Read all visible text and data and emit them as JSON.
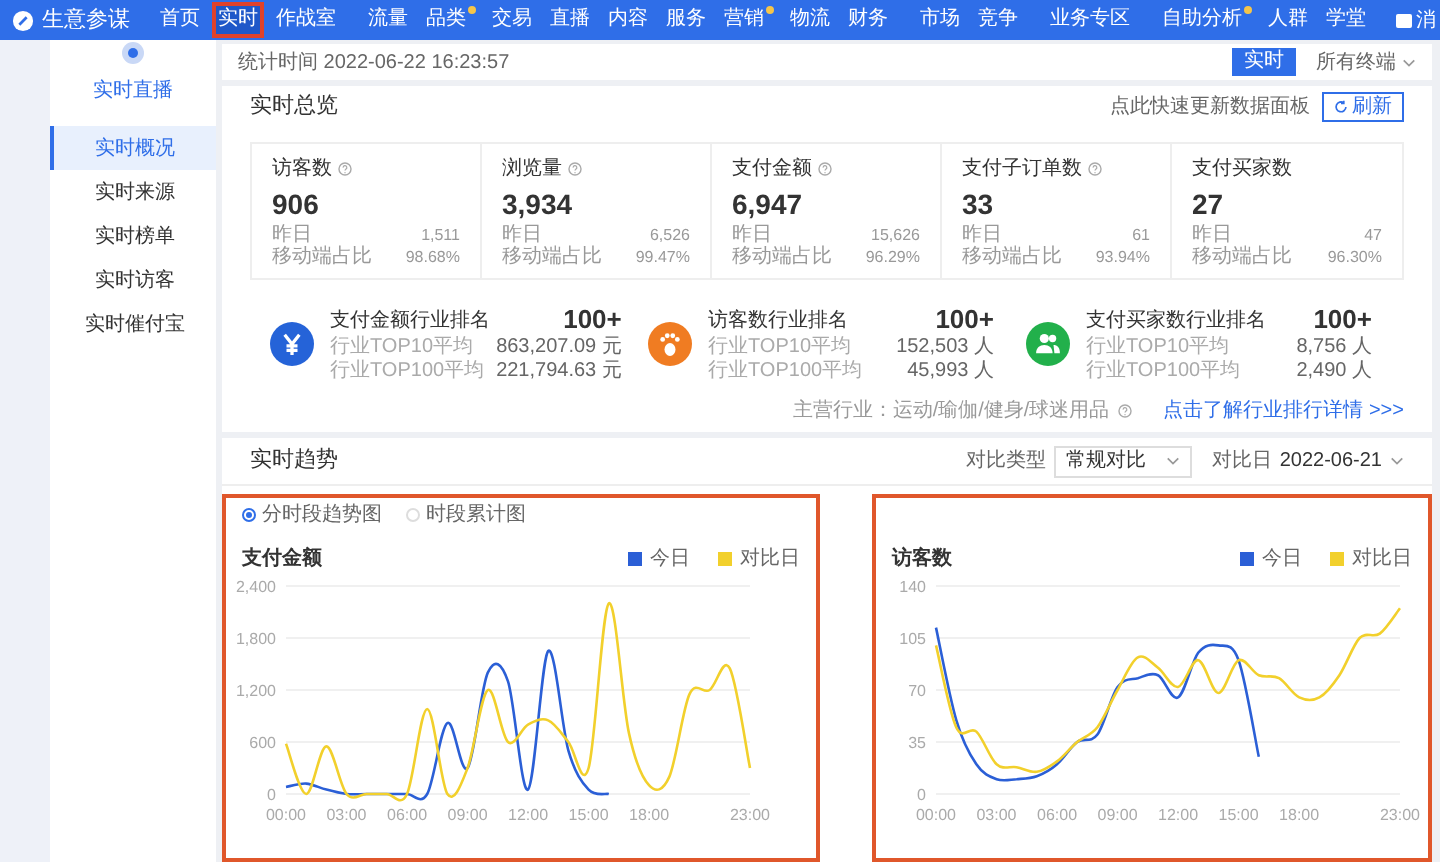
{
  "app": {
    "title": "生意参谋"
  },
  "nav_groups": [
    [
      {
        "label": "首页",
        "selected": false,
        "highlighted": false,
        "dot": false
      },
      {
        "label": "实时",
        "selected": true,
        "highlighted": true,
        "dot": false
      },
      {
        "label": "作战室",
        "selected": false,
        "highlighted": false,
        "dot": false
      }
    ],
    [
      {
        "label": "流量",
        "selected": false,
        "highlighted": false,
        "dot": false
      },
      {
        "label": "品类",
        "selected": false,
        "highlighted": false,
        "dot": true
      },
      {
        "label": "交易",
        "selected": false,
        "highlighted": false,
        "dot": false
      },
      {
        "label": "直播",
        "selected": false,
        "highlighted": false,
        "dot": false
      },
      {
        "label": "内容",
        "selected": false,
        "highlighted": false,
        "dot": false
      },
      {
        "label": "服务",
        "selected": false,
        "highlighted": false,
        "dot": false
      },
      {
        "label": "营销",
        "selected": false,
        "highlighted": false,
        "dot": true
      },
      {
        "label": "物流",
        "selected": false,
        "highlighted": false,
        "dot": false
      },
      {
        "label": "财务",
        "selected": false,
        "highlighted": false,
        "dot": false
      }
    ],
    [
      {
        "label": "市场",
        "selected": false,
        "highlighted": false,
        "dot": false
      },
      {
        "label": "竞争",
        "selected": false,
        "highlighted": false,
        "dot": false
      }
    ],
    [
      {
        "label": "业务专区",
        "selected": false,
        "highlighted": false,
        "dot": false
      }
    ],
    [
      {
        "label": "自助分析",
        "selected": false,
        "highlighted": false,
        "dot": true
      },
      {
        "label": "人群",
        "selected": false,
        "highlighted": false,
        "dot": false
      },
      {
        "label": "学堂",
        "selected": false,
        "highlighted": false,
        "dot": false
      }
    ]
  ],
  "messages": "消",
  "sidebar": {
    "title": "实时直播",
    "items": [
      {
        "label": "实时概况",
        "selected": true
      },
      {
        "label": "实时来源",
        "selected": false
      },
      {
        "label": "实时榜单",
        "selected": false
      },
      {
        "label": "实时访客",
        "selected": false
      },
      {
        "label": "实时催付宝",
        "selected": false
      }
    ]
  },
  "toolbar": {
    "stat_time": "统计时间 2022-06-22 16:23:57",
    "mode_button": "实时",
    "terminal": "所有终端"
  },
  "overview": {
    "title": "实时总览",
    "refresh_hint": "点此快速更新数据面板",
    "refresh_button": "刷新",
    "metrics": [
      {
        "label": "访客数",
        "help": true,
        "value": "906",
        "yesterday_label": "昨日",
        "yesterday": "1,511",
        "mobile_label": "移动端占比",
        "mobile": "98.68%"
      },
      {
        "label": "浏览量",
        "help": true,
        "value": "3,934",
        "yesterday_label": "昨日",
        "yesterday": "6,526",
        "mobile_label": "移动端占比",
        "mobile": "99.47%"
      },
      {
        "label": "支付金额",
        "help": true,
        "value": "6,947",
        "yesterday_label": "昨日",
        "yesterday": "15,626",
        "mobile_label": "移动端占比",
        "mobile": "96.29%"
      },
      {
        "label": "支付子订单数",
        "help": true,
        "value": "33",
        "yesterday_label": "昨日",
        "yesterday": "61",
        "mobile_label": "移动端占比",
        "mobile": "93.94%"
      },
      {
        "label": "支付买家数",
        "help": false,
        "value": "27",
        "yesterday_label": "昨日",
        "yesterday": "47",
        "mobile_label": "移动端占比",
        "mobile": "96.30%"
      }
    ],
    "rankings": [
      {
        "kind": "yuan",
        "color": "#2563d8",
        "title": "支付金额行业排名",
        "rank": "100+",
        "rows": [
          {
            "label": "行业TOP10平均",
            "value": "863,207.09 元"
          },
          {
            "label": "行业TOP100平均",
            "value": "221,794.63 元"
          }
        ]
      },
      {
        "kind": "footprint",
        "color": "#f07c22",
        "title": "访客数行业排名",
        "rank": "100+",
        "rows": [
          {
            "label": "行业TOP10平均",
            "value": "152,503 人"
          },
          {
            "label": "行业TOP100平均",
            "value": "45,993 人"
          }
        ]
      },
      {
        "kind": "people",
        "color": "#22b04b",
        "title": "支付买家数行业排名",
        "rank": "100+",
        "rows": [
          {
            "label": "行业TOP10平均",
            "value": "8,756 人"
          },
          {
            "label": "行业TOP100平均",
            "value": "2,490 人"
          }
        ]
      }
    ],
    "industry": "主营行业：运动/瑜伽/健身/球迷用品",
    "industry_link": "点击了解行业排行详情 >>>"
  },
  "trend": {
    "title": "实时趋势",
    "compare_type_label": "对比类型",
    "compare_type": "常规对比",
    "compare_day_label": "对比日",
    "compare_day": "2022-06-21",
    "panels": [
      {
        "highlighted": true,
        "view_options": [
          {
            "label": "分时段趋势图",
            "selected": true
          },
          {
            "label": "时段累计图",
            "selected": false
          }
        ],
        "chart_data": {
          "type": "line",
          "title": "支付金额",
          "grid": true,
          "legend": "top-right",
          "x": [
            0,
            1,
            2,
            3,
            4,
            5,
            6,
            7,
            8,
            9,
            10,
            11,
            12,
            13,
            14,
            15,
            16,
            17,
            18,
            19,
            20,
            21,
            22,
            23
          ],
          "xlim": [
            0,
            23
          ],
          "ylim": [
            0,
            2400
          ],
          "yticks": [
            {
              "value": 0,
              "label": "0"
            },
            {
              "value": 600,
              "label": "600"
            },
            {
              "value": 1200,
              "label": "1,200"
            },
            {
              "value": 1800,
              "label": "1,800"
            },
            {
              "value": 2400,
              "label": "2,400"
            }
          ],
          "xticks": [
            {
              "value": 0,
              "label": "00:00"
            },
            {
              "value": 3,
              "label": "03:00"
            },
            {
              "value": 6,
              "label": "06:00"
            },
            {
              "value": 9,
              "label": "09:00"
            },
            {
              "value": 12,
              "label": "12:00"
            },
            {
              "value": 15,
              "label": "15:00"
            },
            {
              "value": 18,
              "label": "18:00"
            },
            {
              "value": 23,
              "label": "23:00"
            }
          ],
          "series": [
            {
              "name": "今日",
              "color": "#2b5fd6",
              "values": [
                80,
                120,
                50,
                0,
                0,
                0,
                0,
                0,
                820,
                300,
                1400,
                1300,
                50,
                1650,
                500,
                50,
                0,
                null,
                null,
                null,
                null,
                null,
                null,
                null
              ]
            },
            {
              "name": "对比日",
              "color": "#f2d02c",
              "values": [
                580,
                0,
                550,
                0,
                0,
                0,
                0,
                980,
                0,
                300,
                1200,
                600,
                800,
                850,
                600,
                300,
                2200,
                700,
                100,
                200,
                1150,
                1200,
                1450,
                300
              ]
            }
          ]
        }
      },
      {
        "highlighted": true,
        "chart_data": {
          "type": "line",
          "title": "访客数",
          "grid": true,
          "legend": "top-right",
          "x": [
            0,
            1,
            2,
            3,
            4,
            5,
            6,
            7,
            8,
            9,
            10,
            11,
            12,
            13,
            14,
            15,
            16,
            17,
            18,
            19,
            20,
            21,
            22,
            23
          ],
          "xlim": [
            0,
            23
          ],
          "ylim": [
            0,
            140
          ],
          "yticks": [
            0,
            35,
            70,
            105,
            140
          ],
          "xticks": [
            {
              "value": 0,
              "label": "00:00"
            },
            {
              "value": 3,
              "label": "03:00"
            },
            {
              "value": 6,
              "label": "06:00"
            },
            {
              "value": 9,
              "label": "09:00"
            },
            {
              "value": 12,
              "label": "12:00"
            },
            {
              "value": 15,
              "label": "15:00"
            },
            {
              "value": 18,
              "label": "18:00"
            },
            {
              "value": 23,
              "label": "23:00"
            }
          ],
          "series": [
            {
              "name": "今日",
              "color": "#2b5fd6",
              "values": [
                112,
                50,
                20,
                10,
                10,
                12,
                20,
                35,
                40,
                72,
                78,
                80,
                65,
                95,
                100,
                90,
                25,
                null,
                null,
                null,
                null,
                null,
                null,
                null
              ]
            },
            {
              "name": "对比日",
              "color": "#f2d02c",
              "values": [
                100,
                45,
                42,
                20,
                18,
                15,
                22,
                35,
                45,
                70,
                92,
                85,
                72,
                90,
                68,
                90,
                80,
                78,
                65,
                65,
                80,
                105,
                108,
                125
              ]
            }
          ]
        }
      }
    ]
  }
}
